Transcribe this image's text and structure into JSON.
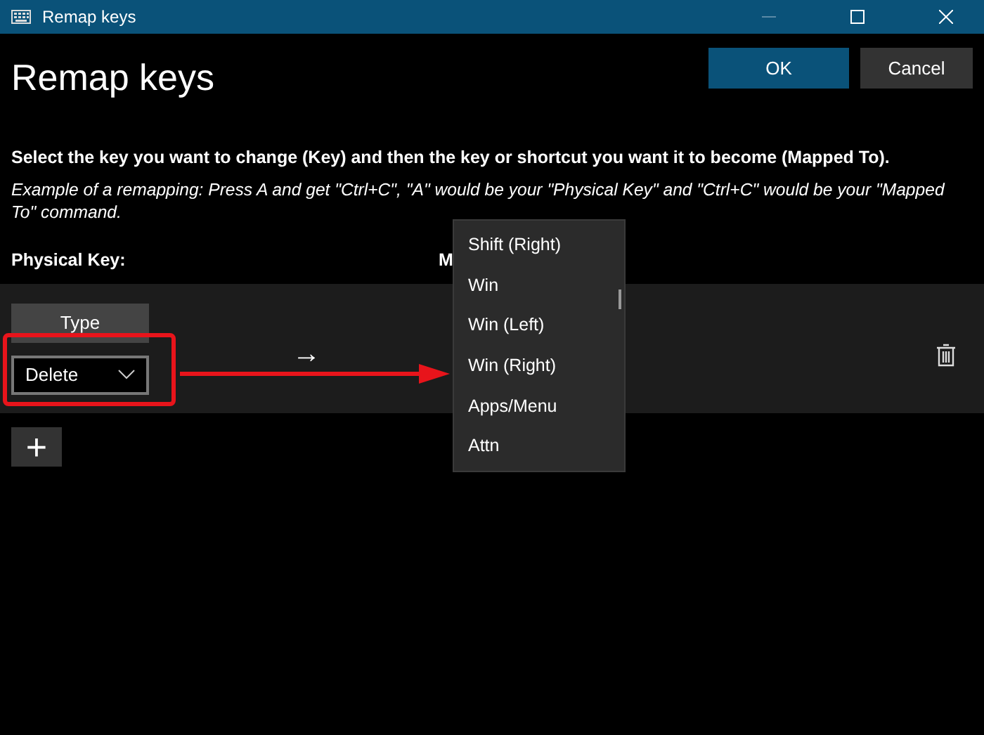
{
  "window": {
    "title": "Remap keys"
  },
  "heading": "Remap keys",
  "buttons": [
    {
      "label": "OK",
      "kind": "primary"
    },
    {
      "label": "Cancel",
      "kind": "secondary"
    }
  ],
  "instruction": "Select the key you want to change (Key) and then the key or shortcut you want it to become (Mapped To).",
  "example": "Example of a remapping: Press A and get \"Ctrl+C\", \"A\" would be your \"Physical Key\" and \"Ctrl+C\" would be your \"Mapped To\" command.",
  "columns": [
    "Physical Key:",
    "M"
  ],
  "row": {
    "type_button": "Type",
    "key": "Delete",
    "arrow": "→"
  },
  "add_button": "+",
  "dropdown_items": [
    {
      "label": "Shift (Right)"
    },
    {
      "label": "Win"
    },
    {
      "label": "Win (Left)"
    },
    {
      "label": "Win (Right)"
    },
    {
      "label": "Apps/Menu"
    },
    {
      "label": "Attn"
    }
  ]
}
